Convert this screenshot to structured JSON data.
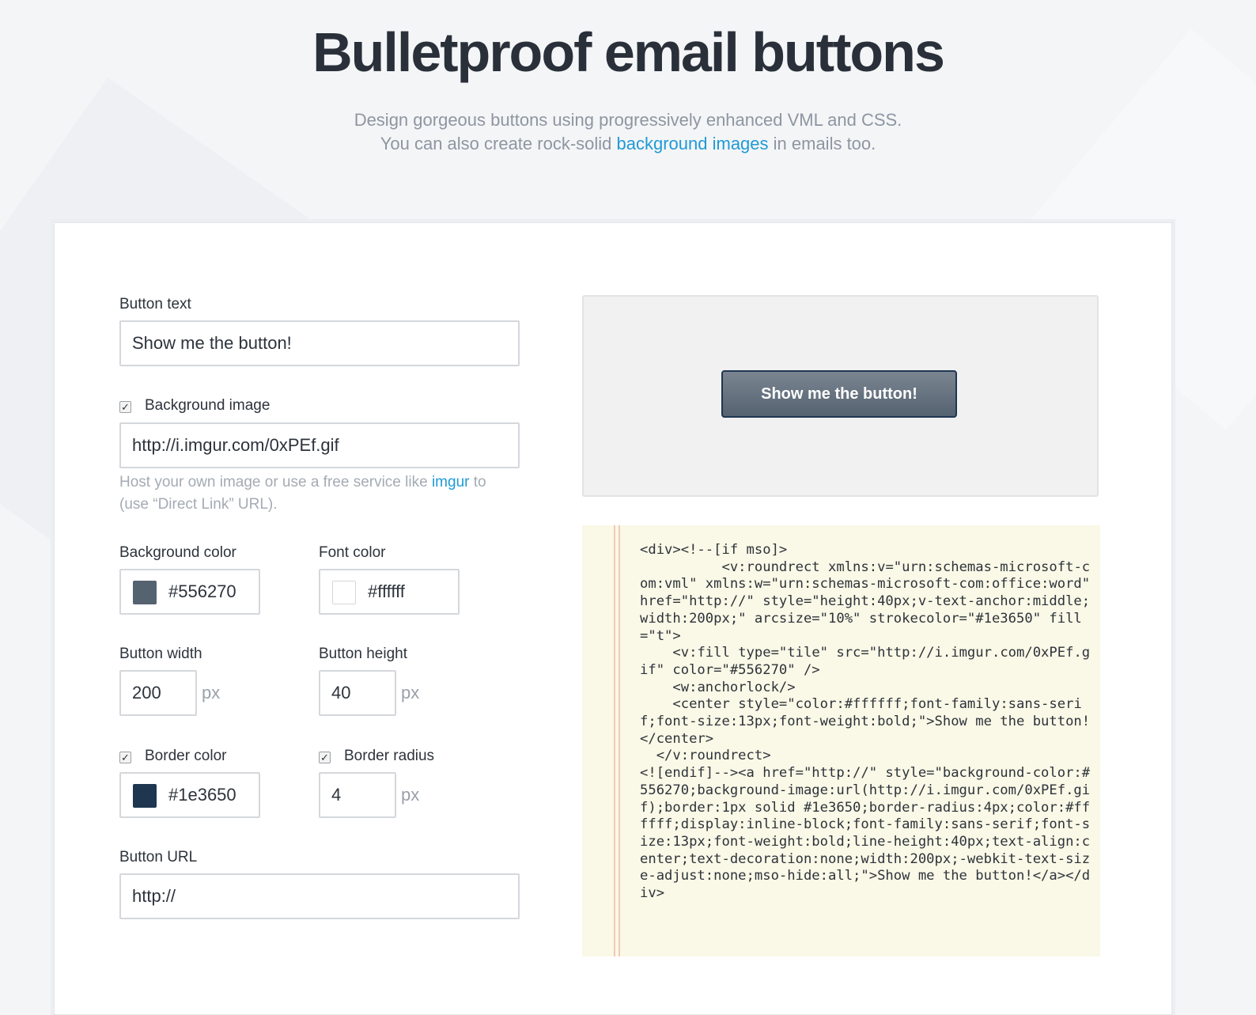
{
  "header": {
    "title": "Bulletproof email buttons",
    "subtitle_line1": "Design gorgeous buttons using progressively enhanced VML and CSS.",
    "subtitle_line2_pre": "You can also create rock-solid ",
    "subtitle_link": "background images",
    "subtitle_line2_post": " in emails too."
  },
  "form": {
    "button_text": {
      "label": "Button text",
      "value": "Show me the button!"
    },
    "background_image": {
      "label": "Background image",
      "checked": true,
      "value": "http://i.imgur.com/0xPEf.gif",
      "hint_pre": "Host your own image or use a free service like ",
      "hint_link": "imgur",
      "hint_post": " to",
      "hint_line2": "(use “Direct Link” URL)."
    },
    "background_color": {
      "label": "Background color",
      "value": "#556270",
      "swatch": "#556270"
    },
    "font_color": {
      "label": "Font color",
      "value": "#ffffff",
      "swatch": "#ffffff"
    },
    "button_width": {
      "label": "Button width",
      "value": "200",
      "unit": "px"
    },
    "button_height": {
      "label": "Button height",
      "value": "40",
      "unit": "px"
    },
    "border_color": {
      "label": "Border color",
      "checked": true,
      "value": "#1e3650",
      "swatch": "#1e3650"
    },
    "border_radius": {
      "label": "Border radius",
      "checked": true,
      "value": "4",
      "unit": "px"
    },
    "button_url": {
      "label": "Button URL",
      "value": "http://"
    }
  },
  "preview": {
    "button_label": "Show me the button!"
  },
  "code": {
    "text": "<div><!--[if mso]>\n          <v:roundrect xmlns:v=\"urn:schemas-microsoft-com:vml\" xmlns:w=\"urn:schemas-microsoft-com:office:word\" href=\"http://\" style=\"height:40px;v-text-anchor:middle;width:200px;\" arcsize=\"10%\" strokecolor=\"#1e3650\" fill=\"t\">\n    <v:fill type=\"tile\" src=\"http://i.imgur.com/0xPEf.gif\" color=\"#556270\" />\n    <w:anchorlock/>\n    <center style=\"color:#ffffff;font-family:sans-serif;font-size:13px;font-weight:bold;\">Show me the button!</center>\n  </v:roundrect>\n<![endif]--><a href=\"http://\" style=\"background-color:#556270;background-image:url(http://i.imgur.com/0xPEf.gif);border:1px solid #1e3650;border-radius:4px;color:#ffffff;display:inline-block;font-family:sans-serif;font-size:13px;font-weight:bold;line-height:40px;text-align:center;text-decoration:none;width:200px;-webkit-text-size-adjust:none;mso-hide:all;\">Show me the button!</a></div>"
  },
  "colors": {
    "accent": "#1f9ad6",
    "title": "#2a3039",
    "code_bg": "#faf8e6",
    "muted": "#8d96a1"
  }
}
